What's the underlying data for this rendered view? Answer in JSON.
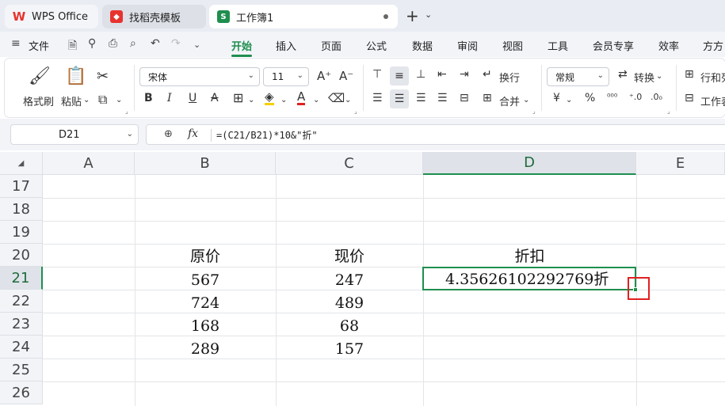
{
  "tabs": {
    "wps": "WPS Office",
    "template": "找稻壳模板",
    "workbook": "工作簿1"
  },
  "menu": [
    "文件",
    "开始",
    "插入",
    "页面",
    "公式",
    "数据",
    "审阅",
    "视图",
    "工具",
    "会员专享",
    "效率",
    "方方"
  ],
  "ribbon": {
    "format_painter": "格式刷",
    "paste": "粘贴",
    "font_name": "宋体",
    "font_size": "11",
    "wrap": "换行",
    "merge": "合并",
    "number_format": "常规",
    "convert": "转换",
    "row_col": "行和列",
    "worksheet": "工作表",
    "bold": "B",
    "italic": "I",
    "underline": "U",
    "strike": "A",
    "font_color": "A",
    "font_grow": "A⁺",
    "font_shrink": "A⁻",
    "currency": "¥",
    "percent": "%"
  },
  "formula_bar": {
    "name_box": "D21",
    "fx": "fx",
    "formula": "=(C21/B21)*10&\"折\""
  },
  "columns": [
    "A",
    "B",
    "C",
    "D",
    "E"
  ],
  "rows": [
    "17",
    "18",
    "19",
    "20",
    "21",
    "22",
    "23",
    "24",
    "25",
    "26"
  ],
  "cells": {
    "B20": "原价",
    "C20": "现价",
    "D20": "折扣",
    "B21": "567",
    "C21": "247",
    "D21": "4.35626102292769折",
    "B22": "724",
    "C22": "489",
    "B23": "168",
    "C23": "68",
    "B24": "289",
    "C24": "157"
  },
  "colors": {
    "accent": "#1f8e4f",
    "highlight_box": "#e02020"
  }
}
